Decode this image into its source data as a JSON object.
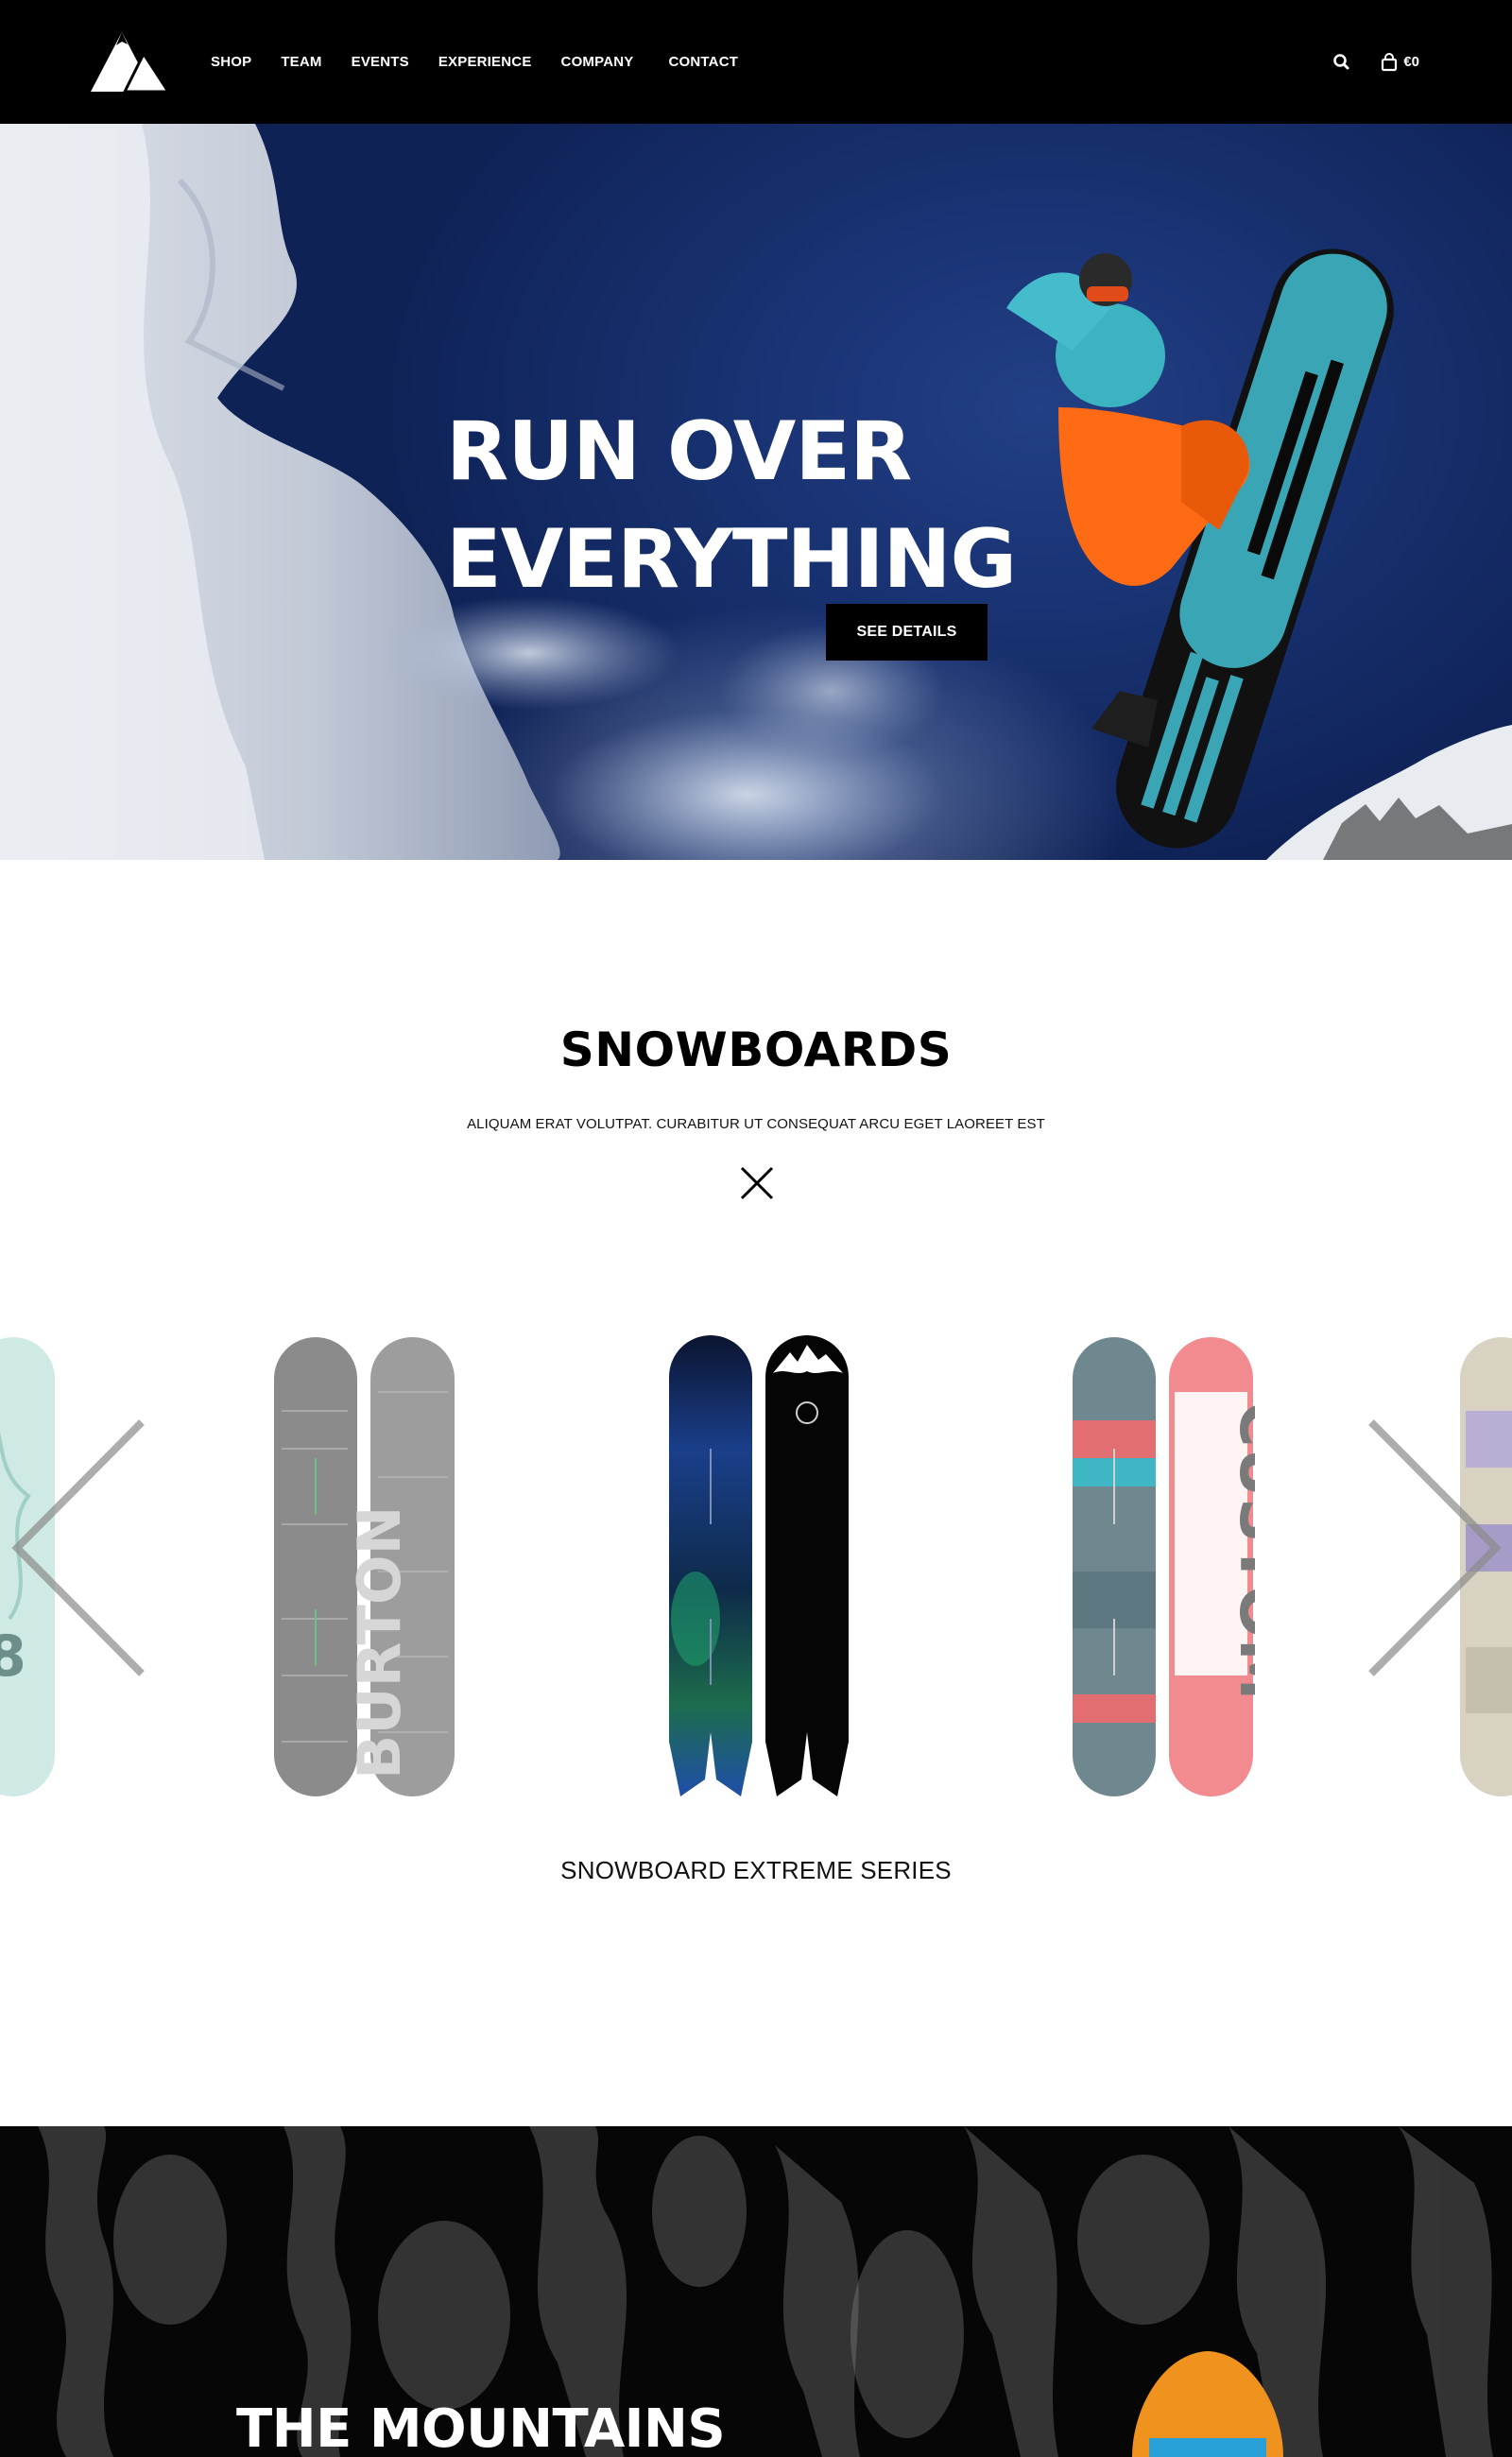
{
  "nav": {
    "items": [
      {
        "label": "SHOP"
      },
      {
        "label": "TEAM"
      },
      {
        "label": "EVENTS"
      },
      {
        "label": "EXPERIENCE"
      },
      {
        "label": "COMPANY"
      },
      {
        "label": "CONTACT"
      }
    ],
    "cart_total": "€0",
    "icons": {
      "logo": "mountain-logo",
      "search": "search-icon",
      "cart": "shopping-bag-icon"
    }
  },
  "hero": {
    "title_line1": "RUN OVER",
    "title_line2": "EVERYTHING",
    "button_label": "SEE DETAILS"
  },
  "snowboards": {
    "title": "SNOWBOARDS",
    "subtitle": "ALIQUAM ERAT VOLUTPAT. CURABITUR UT CONSEQUAT ARCU EGET LAOREET EST",
    "divider_icon": "x-mark-icon",
    "product_name": "SNOWBOARD EXTREME SERIES",
    "boards": [
      {
        "brand": "BURTON",
        "colors": [
          "#8a8a8a",
          "#9a9a9a"
        ]
      },
      {
        "brand": "",
        "colors": [
          "#0e1a3a",
          "#000000"
        ]
      },
      {
        "brand": "CUSTOM",
        "colors": [
          "#6f8890",
          "#f08a8c"
        ]
      }
    ],
    "prev_icon": "chevron-left-icon",
    "next_icon": "chevron-right-icon"
  },
  "mountains": {
    "title": "THE MOUNTAINS"
  },
  "colors": {
    "nav_bg": "#000000",
    "hero_sky": "#183272",
    "button_bg": "#000000",
    "text": "#111111"
  }
}
